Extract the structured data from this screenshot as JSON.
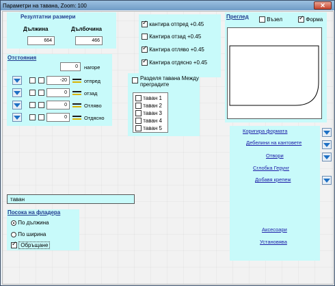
{
  "window": {
    "title": "Параметри на тавана,  Zoom:  100",
    "close_label": "✕"
  },
  "result_sizes": {
    "title": "Резултатни размери",
    "length_label": "Дължина",
    "depth_label": "Дълбочина",
    "length_value": "664",
    "depth_value": "466"
  },
  "edge_checks": [
    {
      "label": "кантира отпред  +0.45",
      "checked": true
    },
    {
      "label": "Кантира отзад  +0.45",
      "checked": false
    },
    {
      "label": "Кантира отляво  +0.45",
      "checked": true
    },
    {
      "label": "Кантира отдясно  +0.45",
      "checked": true
    }
  ],
  "preview": {
    "title": "Преглед",
    "node_label": "Възел",
    "node_checked": false,
    "shape_label": "Форма",
    "shape_checked": true
  },
  "distances": {
    "title": "Отстояния",
    "top_value": "0",
    "top_label": "нагоре",
    "rows": [
      {
        "value": "-20",
        "label": "отпред"
      },
      {
        "value": "0",
        "label": "отзад"
      },
      {
        "value": "0",
        "label": "Отляво"
      },
      {
        "value": "0",
        "label": "Отдясно"
      }
    ]
  },
  "split": {
    "label": "Разделя тавана Между преградите",
    "items": [
      "таван 1",
      "таван 2",
      "таван 3",
      "таван 4",
      "таван 5"
    ]
  },
  "actions": {
    "links": [
      "Коригира формата",
      "Дебелини на кантовете",
      "Отвори",
      "Сглобка Герунг",
      "Добавя крепеж"
    ],
    "bottom_links": [
      "Аксесоари",
      "Установява"
    ]
  },
  "name_field": {
    "value": "таван"
  },
  "grain": {
    "title": "Посока на фладера",
    "by_length": "По дължина",
    "by_width": "По ширина",
    "rotate": "Обръщане",
    "selected": "length",
    "rotate_checked": true
  }
}
